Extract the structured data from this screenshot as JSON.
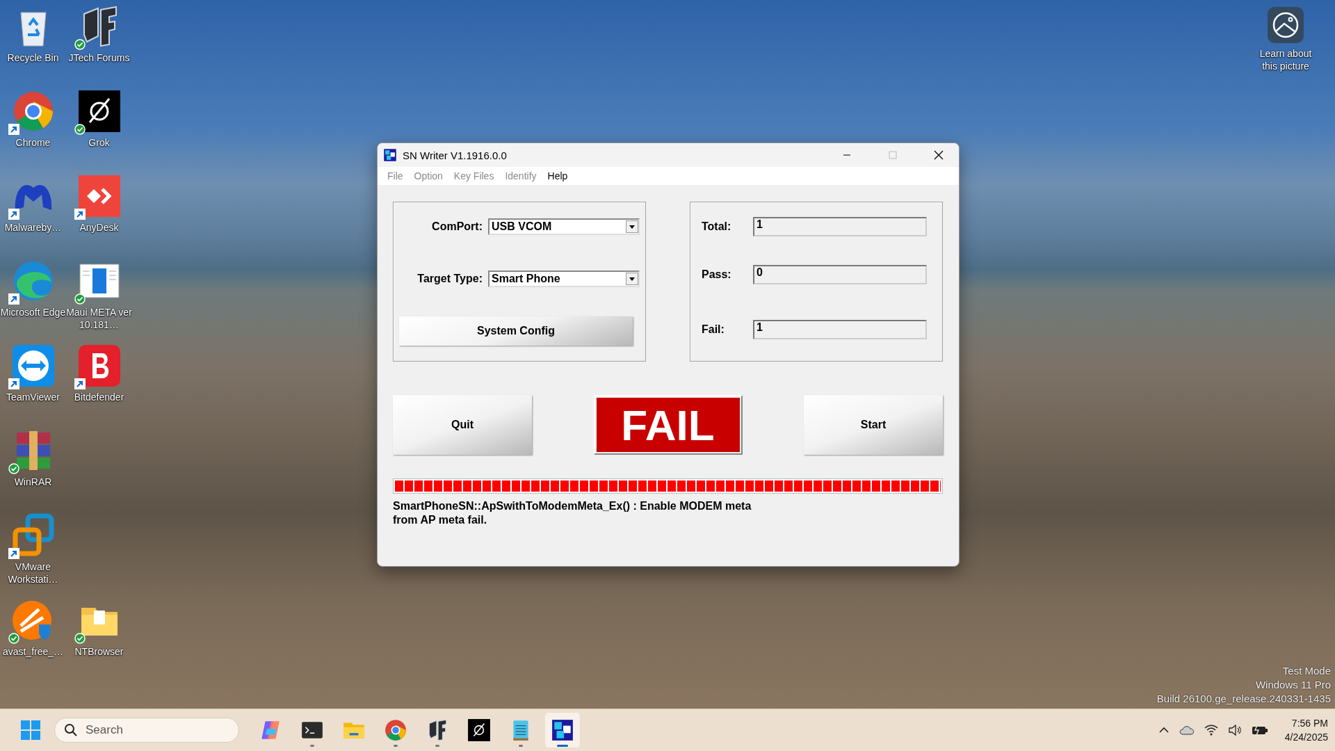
{
  "desktop": {
    "icon_rows": [
      [
        {
          "label": "Recycle Bin",
          "kind": "bin",
          "shortcut": false,
          "synced": false
        },
        {
          "label": "JTech Forums",
          "kind": "jf",
          "shortcut": false,
          "synced": true
        }
      ],
      [
        {
          "label": "Chrome",
          "kind": "chrome",
          "shortcut": true,
          "synced": false
        },
        {
          "label": "Grok",
          "kind": "grok",
          "shortcut": false,
          "synced": true
        }
      ],
      [
        {
          "label": "Malwareby…",
          "kind": "malware",
          "shortcut": true,
          "synced": false
        },
        {
          "label": "AnyDesk",
          "kind": "anydesk",
          "shortcut": true,
          "synced": false
        }
      ],
      [
        {
          "label": "Microsoft Edge",
          "kind": "edge",
          "shortcut": true,
          "synced": false
        },
        {
          "label": "Maui META ver 10.181…",
          "kind": "doc",
          "shortcut": false,
          "synced": true
        }
      ],
      [
        {
          "label": "TeamViewer",
          "kind": "teamviewer",
          "shortcut": true,
          "synced": false
        },
        {
          "label": "Bitdefender",
          "kind": "bitdefender",
          "shortcut": true,
          "synced": false
        }
      ],
      [
        {
          "label": "WinRAR",
          "kind": "winrar",
          "shortcut": false,
          "synced": true
        }
      ],
      [
        {
          "label": "VMware Workstati…",
          "kind": "vmware",
          "shortcut": true,
          "synced": false
        }
      ],
      [
        {
          "label": "avast_free_…",
          "kind": "avast",
          "shortcut": false,
          "synced": true
        },
        {
          "label": "NTBrowser",
          "kind": "folder",
          "shortcut": false,
          "synced": true
        }
      ]
    ],
    "spotlight": {
      "label": "Learn about this picture"
    },
    "watermark": [
      "Test Mode",
      "Windows 11 Pro",
      "Build 26100.ge_release.240331-1435"
    ]
  },
  "window": {
    "title": "SN Writer V1.1916.0.0",
    "menu": [
      {
        "label": "File",
        "disabled": true
      },
      {
        "label": "Option",
        "disabled": true
      },
      {
        "label": "Key Files",
        "disabled": true
      },
      {
        "label": "Identify",
        "disabled": true
      },
      {
        "label": "Help",
        "disabled": false
      }
    ],
    "settings": {
      "comport_label": "ComPort:",
      "comport_value": "USB VCOM",
      "target_label": "Target Type:",
      "target_value": "Smart Phone",
      "config_button": "System Config"
    },
    "counters": [
      {
        "label": "Total:",
        "value": "1"
      },
      {
        "label": "Pass:",
        "value": "0"
      },
      {
        "label": "Fail:",
        "value": "1"
      }
    ],
    "quit_button": "Quit",
    "start_button": "Start",
    "result": {
      "text": "FAIL"
    },
    "progress": {
      "level": 1
    },
    "message": "SmartPhoneSN::ApSwithToModemMeta_Ex() : Enable MODEM meta\nfrom AP meta fail."
  },
  "taskbar": {
    "search_placeholder": "Search",
    "apps": [
      {
        "kind": "copilot",
        "running": false,
        "selected": false
      },
      {
        "kind": "terminal",
        "running": true,
        "selected": false
      },
      {
        "kind": "explorer",
        "running": false,
        "selected": false
      },
      {
        "kind": "chrome",
        "running": true,
        "selected": false
      },
      {
        "kind": "jf",
        "running": true,
        "selected": false
      },
      {
        "kind": "grok",
        "running": false,
        "selected": false
      },
      {
        "kind": "notepad",
        "running": true,
        "selected": false
      },
      {
        "kind": "snwriter",
        "running": true,
        "selected": true
      }
    ],
    "time": "7:56 PM",
    "date": "4/24/2025"
  }
}
